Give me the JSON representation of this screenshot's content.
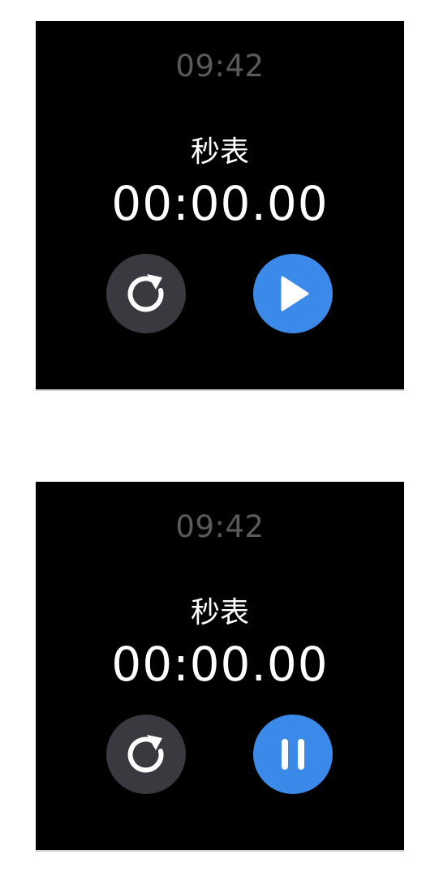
{
  "screens": [
    {
      "status_time": "09:42",
      "title": "秒表",
      "timer": "00:00.00",
      "reset_icon": "reset-icon",
      "primary_icon": "play-icon"
    },
    {
      "status_time": "09:42",
      "title": "秒表",
      "timer": "00:00.00",
      "reset_icon": "reset-icon",
      "primary_icon": "pause-icon"
    }
  ],
  "colors": {
    "background": "#000000",
    "clock_text": "#5a5a5a",
    "text": "#ffffff",
    "reset_button": "#3a393f",
    "primary_button": "#3b8ae9"
  }
}
